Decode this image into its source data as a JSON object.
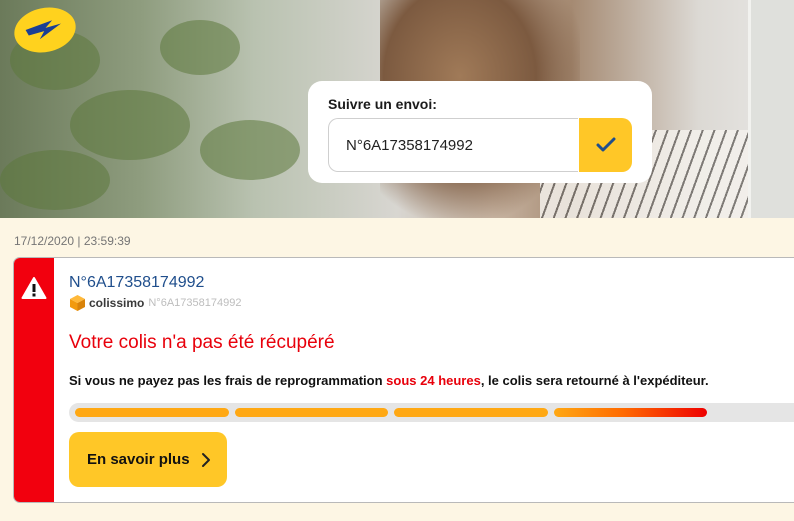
{
  "tracking": {
    "label": "Suivre un envoi:",
    "value": "N°6A17358174992",
    "submit_icon": "checkmark-icon"
  },
  "timestamp": "17/12/2020 | 23:59:39",
  "card": {
    "parcel_number": "N°6A17358174992",
    "carrier_name": "colissimo",
    "carrier_number": "N°6A17358174992",
    "alert_title": "Votre colis n'a pas été récupéré",
    "message_before": "Si vous ne payez pas les frais de reprogrammation ",
    "message_deadline": "sous 24 heures",
    "message_after": ", le colis sera retourné à l'expéditeur.",
    "progress_steps_total": 5,
    "progress_steps_done": 4,
    "button_label": "En savoir plus"
  },
  "colors": {
    "brand_yellow": "#ffc727",
    "alert_red": "#f2000e",
    "link_blue": "#1f4e8c",
    "page_background": "#fdf6e4"
  },
  "icons": [
    "la-poste-logo",
    "checkmark-icon",
    "warning-icon",
    "package-box-icon",
    "chevron-right-icon"
  ]
}
